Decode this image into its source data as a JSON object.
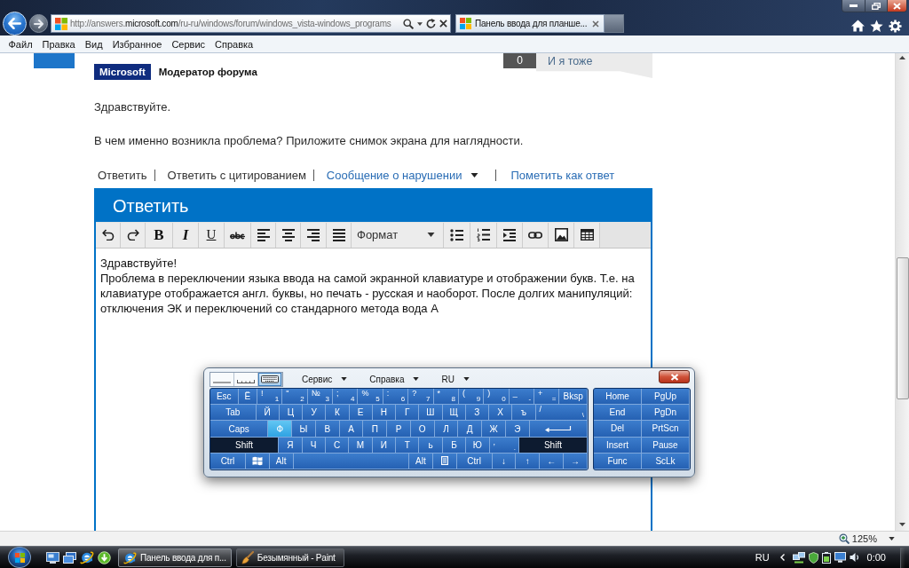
{
  "browser": {
    "address": "http://answers.**microsoft.com**/ru-ru/windows/forum/windows_vista-windows_programs",
    "tabs": [
      {
        "title": "Панель ввода для планше...",
        "selected": true
      }
    ],
    "menu": [
      "Файл",
      "Правка",
      "Вид",
      "Избранное",
      "Сервис",
      "Справка"
    ]
  },
  "post": {
    "badge": "Microsoft",
    "role": "Модератор форума",
    "vote_count": "0",
    "vote_label": "И я тоже",
    "paragraphs": [
      "Здравствуйте.",
      "В чем именно возникла проблема? Приложите снимок экрана для наглядности."
    ],
    "actions": [
      {
        "label": "Ответить",
        "kind": "plain"
      },
      {
        "label": "Ответить с цитированием",
        "kind": "plain"
      },
      {
        "label": "Сообщение о нарушении",
        "kind": "menu"
      },
      {
        "label": "Пометить как ответ",
        "kind": "link"
      }
    ]
  },
  "reply": {
    "title": "Ответить",
    "format_buttons": [
      "B",
      "I",
      "U"
    ],
    "style_select": "Формат",
    "editor": {
      "paragraphs": [
        "Здравствуйте!",
        "Проблема в переключении языка ввода на самой экранной клавиатуре и отображении букв. Т.е. на клавиатуре отображается англ. буквы, но печать - русская и наоборот. После долгих манипуляций: отключения ЭК и переключений со стандарного метода вода А"
      ]
    }
  },
  "keyboard": {
    "modes": [
      {
        "selected": false
      },
      {
        "selected": false
      },
      {
        "selected": true
      }
    ],
    "menus": [
      "Сервис",
      "Справка",
      "RU"
    ],
    "rows": [
      {
        "keys": [
          {
            "kind": "text",
            "label": "Esc",
            "pressed": false,
            "hovered": false
          },
          {
            "kind": "text",
            "label": "Ё",
            "pressed": false,
            "hovered": false
          },
          {
            "kind": "dual",
            "top": "!",
            "label": "1",
            "pressed": false,
            "hovered": false
          },
          {
            "kind": "dual",
            "top": "\"",
            "label": "2",
            "pressed": false,
            "hovered": false
          },
          {
            "kind": "dual",
            "top": "№",
            "label": "3",
            "pressed": false,
            "hovered": false
          },
          {
            "kind": "dual",
            "top": ";",
            "label": "4",
            "pressed": false,
            "hovered": false
          },
          {
            "kind": "dual",
            "top": "%",
            "label": "5",
            "pressed": false,
            "hovered": false
          },
          {
            "kind": "dual",
            "top": ":",
            "label": "6",
            "pressed": false,
            "hovered": false
          },
          {
            "kind": "dual",
            "top": "?",
            "label": "7",
            "pressed": false,
            "hovered": false
          },
          {
            "kind": "dual",
            "top": "*",
            "label": "8",
            "pressed": false,
            "hovered": false
          },
          {
            "kind": "dual",
            "top": "(",
            "label": "9",
            "pressed": false,
            "hovered": false
          },
          {
            "kind": "dual",
            "top": ")",
            "label": "0",
            "pressed": false,
            "hovered": false
          },
          {
            "kind": "dual",
            "top": "_",
            "label": "-",
            "pressed": false,
            "hovered": false
          },
          {
            "kind": "dual",
            "top": "+",
            "label": "=",
            "pressed": false,
            "hovered": false
          },
          {
            "kind": "text",
            "label": "Bksp",
            "pressed": false,
            "hovered": false
          }
        ]
      },
      {
        "keys": [
          {
            "kind": "text",
            "label": "Tab",
            "pressed": false,
            "hovered": false
          },
          {
            "kind": "text",
            "label": "Й",
            "pressed": false,
            "hovered": false
          },
          {
            "kind": "text",
            "label": "Ц",
            "pressed": false,
            "hovered": false
          },
          {
            "kind": "text",
            "label": "У",
            "pressed": false,
            "hovered": false
          },
          {
            "kind": "text",
            "label": "К",
            "pressed": false,
            "hovered": false
          },
          {
            "kind": "text",
            "label": "Е",
            "pressed": false,
            "hovered": false
          },
          {
            "kind": "text",
            "label": "Н",
            "pressed": false,
            "hovered": false
          },
          {
            "kind": "text",
            "label": "Г",
            "pressed": false,
            "hovered": false
          },
          {
            "kind": "text",
            "label": "Ш",
            "pressed": false,
            "hovered": false
          },
          {
            "kind": "text",
            "label": "Щ",
            "pressed": false,
            "hovered": false
          },
          {
            "kind": "text",
            "label": "З",
            "pressed": false,
            "hovered": false
          },
          {
            "kind": "text",
            "label": "Х",
            "pressed": false,
            "hovered": false
          },
          {
            "kind": "text",
            "label": "ъ",
            "pressed": false,
            "hovered": false
          },
          {
            "kind": "dual",
            "top": "/",
            "label": "\\",
            "pressed": false,
            "hovered": false
          }
        ]
      },
      {
        "keys": [
          {
            "kind": "text",
            "label": "Caps",
            "pressed": false,
            "hovered": false
          },
          {
            "kind": "text",
            "label": "Ф",
            "pressed": false,
            "hovered": true
          },
          {
            "kind": "text",
            "label": "Ы",
            "pressed": false,
            "hovered": false
          },
          {
            "kind": "text",
            "label": "В",
            "pressed": false,
            "hovered": false
          },
          {
            "kind": "text",
            "label": "А",
            "pressed": false,
            "hovered": false
          },
          {
            "kind": "text",
            "label": "П",
            "pressed": false,
            "hovered": false
          },
          {
            "kind": "text",
            "label": "Р",
            "pressed": false,
            "hovered": false
          },
          {
            "kind": "text",
            "label": "О",
            "pressed": false,
            "hovered": false
          },
          {
            "kind": "text",
            "label": "Л",
            "pressed": false,
            "hovered": false
          },
          {
            "kind": "text",
            "label": "Д",
            "pressed": false,
            "hovered": false
          },
          {
            "kind": "text",
            "label": "Ж",
            "pressed": false,
            "hovered": false
          },
          {
            "kind": "text",
            "label": "Э",
            "pressed": false,
            "hovered": false
          },
          {
            "kind": "enter",
            "pressed": false,
            "hovered": false
          }
        ]
      },
      {
        "keys": [
          {
            "kind": "text",
            "label": "Shift",
            "pressed": true,
            "hovered": false
          },
          {
            "kind": "text",
            "label": "Я",
            "pressed": false,
            "hovered": false
          },
          {
            "kind": "text",
            "label": "Ч",
            "pressed": false,
            "hovered": false
          },
          {
            "kind": "text",
            "label": "С",
            "pressed": false,
            "hovered": false
          },
          {
            "kind": "text",
            "label": "М",
            "pressed": false,
            "hovered": false
          },
          {
            "kind": "text",
            "label": "И",
            "pressed": false,
            "hovered": false
          },
          {
            "kind": "text",
            "label": "Т",
            "pressed": false,
            "hovered": false
          },
          {
            "kind": "text",
            "label": "ь",
            "pressed": false,
            "hovered": false
          },
          {
            "kind": "text",
            "label": "Б",
            "pressed": false,
            "hovered": false
          },
          {
            "kind": "text",
            "label": "Ю",
            "pressed": false,
            "hovered": false
          },
          {
            "kind": "dual",
            "top": ",",
            "label": ".",
            "pressed": false,
            "hovered": false
          },
          {
            "kind": "text",
            "label": "Shift",
            "pressed": true,
            "hovered": false
          }
        ]
      },
      {
        "keys": [
          {
            "kind": "text",
            "label": "Ctrl",
            "pressed": false,
            "hovered": false
          },
          {
            "kind": "win",
            "pressed": false,
            "hovered": false
          },
          {
            "kind": "text",
            "label": "Alt",
            "pressed": false,
            "hovered": false
          },
          {
            "kind": "space",
            "pressed": false,
            "hovered": false
          },
          {
            "kind": "text",
            "label": "Alt",
            "pressed": false,
            "hovered": false
          },
          {
            "kind": "menu",
            "pressed": false,
            "hovered": false
          },
          {
            "kind": "text",
            "label": "Ctrl",
            "pressed": false,
            "hovered": false
          },
          {
            "kind": "text",
            "label": "↓",
            "pressed": false,
            "hovered": false
          },
          {
            "kind": "text",
            "label": "↑",
            "pressed": false,
            "hovered": false
          },
          {
            "kind": "text",
            "label": "←",
            "pressed": false,
            "hovered": false
          },
          {
            "kind": "text",
            "label": "→",
            "pressed": false,
            "hovered": false
          }
        ]
      }
    ],
    "nav_keys": [
      "Home",
      "PgUp",
      "End",
      "PgDn",
      "Del",
      "PrtScn",
      "Insert",
      "Pause",
      "Func",
      "ScLk"
    ]
  },
  "status_bar": {
    "zoom": "125%"
  },
  "taskbar": {
    "tasks": [
      {
        "title": "Панель ввода для п...",
        "selected": true
      },
      {
        "title": "Безымянный - Paint",
        "selected": false
      }
    ],
    "language": "RU",
    "clock": "0:00"
  }
}
